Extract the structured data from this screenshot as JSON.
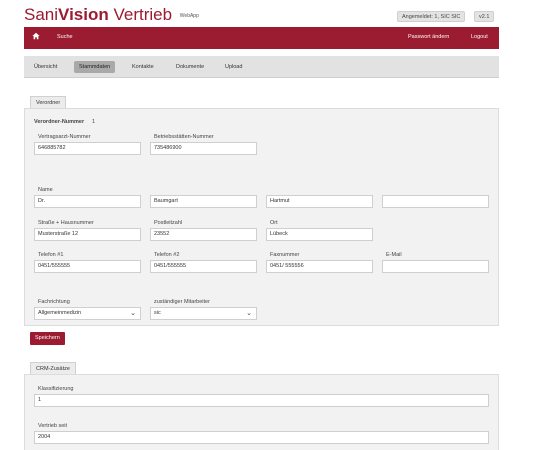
{
  "header": {
    "brand_part1": "Sani",
    "brand_part2": "Vision",
    "brand_part3": " Vertrieb",
    "brand_sub": "WebApp",
    "login_status": "Angemeldet: 1, SIC SIC",
    "version": "v2.1"
  },
  "navbar": {
    "search_label": "Suche",
    "password_label": "Passwort ändern",
    "logout_label": "Logout"
  },
  "subnav": {
    "tabs": [
      "Übersicht",
      "Stammdaten",
      "Kontakte",
      "Dokumente",
      "Upload"
    ],
    "active": "Stammdaten"
  },
  "verordner": {
    "tab_label": "Verordner",
    "number_label": "Verordner-Nummer",
    "number_value": "1",
    "vertragsarzt_label": "Vertragsarzt-Nummer",
    "vertragsarzt_value": "646885782",
    "betriebsstaetten_label": "Betriebsstätten-Nummer",
    "betriebsstaetten_value": "735486900",
    "name_label": "Name",
    "title_value": "Dr.",
    "lastname_value": "Baumgart",
    "firstname_value": "Hartmut",
    "name_extra_value": "",
    "street_label": "Straße + Hausnummer",
    "street_value": "Musterstraße 12",
    "zip_label": "Postleitzahl",
    "zip_value": "23552",
    "city_label": "Ort",
    "city_value": "Lübeck",
    "phone1_label": "Telefon #1",
    "phone1_value": "0451/555555",
    "phone2_label": "Telefon #2",
    "phone2_value": "0451/555555",
    "fax_label": "Faxnummer",
    "fax_value": "0451/ 555556",
    "email_label": "E-Mail",
    "email_value": "",
    "specialty_label": "Fachrichtung",
    "specialty_value": "Allgemeinmedizin",
    "staff_label": "zuständiger Mitarbeiter",
    "staff_value": "sic",
    "save_label": "Speichern"
  },
  "crm": {
    "tab_label": "CRM-Zusätze",
    "class_label": "Klassifizierung",
    "class_value": "1",
    "since_label": "Vertrieb seit",
    "since_value": "2004"
  },
  "colors": {
    "brand": "#9b1b30",
    "subnav_bg": "#e2e2e2",
    "panel_bg": "#f2f2f2"
  }
}
